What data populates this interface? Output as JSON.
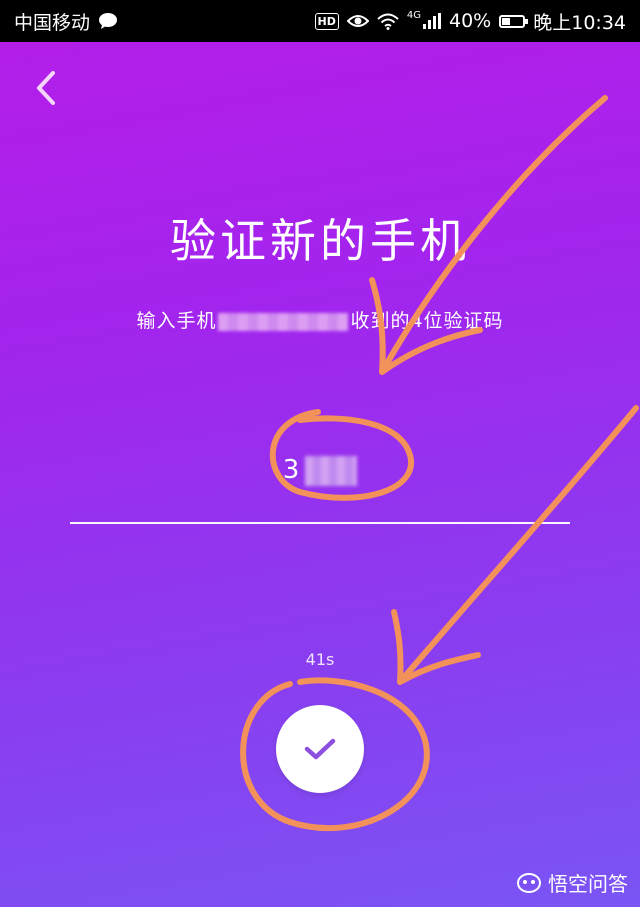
{
  "status_bar": {
    "carrier": "中国移动",
    "hd": "HD",
    "network": "4G",
    "battery": "40%",
    "battery_level": 0.4,
    "time": "晚上10:34"
  },
  "screen": {
    "title": "验证新的手机",
    "subtitle_prefix": "输入手机",
    "subtitle_suffix": "收到的4位验证码",
    "code_visible": "3",
    "countdown": "41s"
  },
  "icons": {
    "back": "chevron-left-icon",
    "confirm": "checkmark-icon",
    "chat": "chat-bubble-icon",
    "eye": "eye-icon",
    "wifi": "wifi-icon",
    "signal": "signal-icon"
  },
  "colors": {
    "accent": "#8a3df0",
    "check": "#8c4fe0",
    "annotation": "#f3915a"
  },
  "watermark": {
    "text": "悟空问答"
  }
}
